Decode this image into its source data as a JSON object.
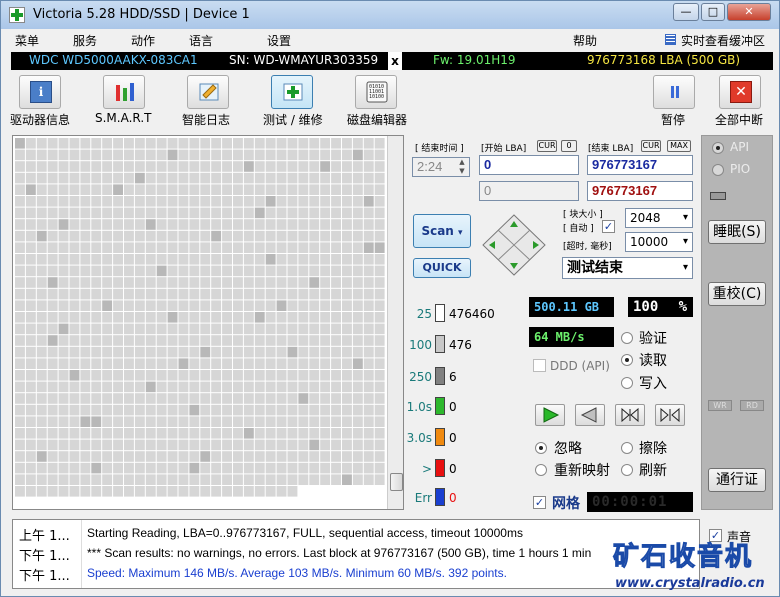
{
  "window": {
    "title": "Victoria 5.28 HDD/SSD | Device 1",
    "minimize": "—",
    "maximize": "□",
    "close": "✕"
  },
  "menu": {
    "items": [
      "菜单",
      "服务",
      "动作",
      "语言",
      "设置",
      "帮助"
    ],
    "cache_view": "实时查看缓冲区"
  },
  "drive": {
    "model": "WDC WD5000AAKX-083CA1",
    "serial": "SN: WD-WMAYUR303359",
    "close": "x",
    "firmware": "Fw: 19.01H19",
    "capacity": "976773168 LBA (500 GB)"
  },
  "toolbar": [
    {
      "label": "驱动器信息",
      "icon": "info-icon"
    },
    {
      "label": "S.M.A.R.T",
      "icon": "smart-icon"
    },
    {
      "label": "智能日志",
      "icon": "log-icon"
    },
    {
      "label": "测试 / 维修",
      "icon": "test-icon"
    },
    {
      "label": "磁盘编辑器",
      "icon": "disk-editor-icon"
    },
    {
      "label": "暂停",
      "icon": "pause-icon"
    },
    {
      "label": "全部中断",
      "icon": "abort-icon"
    }
  ],
  "scan": {
    "end_time_label": "[ 结束时间 ]",
    "start_lba_label": "[开始 LBA]",
    "cur_label": "CUR",
    "zero_label": "0",
    "end_lba_label": "[结束 LBA]",
    "max_label": "MAX",
    "time": "2:24",
    "start_lba": "0",
    "end_lba": "976773167",
    "current_lba": "0",
    "current_end_lba": "976773167",
    "scan_button": "Scan",
    "quick_button": "QUICK",
    "block_size_label": "[ 块大小 ]",
    "auto_label": "[ 自动 ]",
    "timeout_label": "[超时, 毫秒]",
    "block_size": "2048",
    "timeout": "10000",
    "status": "测试结束"
  },
  "legend": [
    {
      "label": "25",
      "count": "476460",
      "color": "#ffffff"
    },
    {
      "label": "100",
      "count": "476",
      "color": "#c8c8c8"
    },
    {
      "label": "250",
      "count": "6",
      "color": "#808080"
    },
    {
      "label": "1.0s",
      "count": "0",
      "color": "#2db82d"
    },
    {
      "label": "3.0s",
      "count": "0",
      "color": "#f08a10"
    },
    {
      "label": ">",
      "count": "0",
      "color": "#e81010"
    },
    {
      "label": "Err",
      "count": "0",
      "color": "#1a3fd0"
    }
  ],
  "stats": {
    "scanned": "500.11 GB",
    "percent": "100",
    "percent_unit": "%",
    "speed": "64 MB/s",
    "ddd": "DDD (API)"
  },
  "modes": {
    "verify": "验证",
    "read": "读取",
    "write": "写入"
  },
  "repair": {
    "ignore": "忽略",
    "erase": "擦除",
    "remap": "重新映射",
    "refresh": "刷新"
  },
  "grid": {
    "label": "网格",
    "timer": "00:00:01"
  },
  "right_panel": {
    "api": "API",
    "pio": "PIO",
    "sleep": "睡眠(S)",
    "recal": "重校(C)",
    "wr": "WR",
    "rd": "RD",
    "passport": "通行证",
    "sound": "声音"
  },
  "log": [
    {
      "time": "上午 1...",
      "msg": "Starting Reading, LBA=0..976773167, FULL, sequential access, timeout 10000ms",
      "color": "#000000"
    },
    {
      "time": "下午 1...",
      "msg": "*** Scan results: no warnings, no errors. Last block at 976773167 (500 GB), time 1 hours 1 min",
      "color": "#000000"
    },
    {
      "time": "下午 1...",
      "msg": "Speed: Maximum 146 MB/s. Average 103 MB/s. Minimum 60 MB/s. 392 points.",
      "color": "#1a3fd0"
    }
  ],
  "watermark": {
    "title": "矿石收音机",
    "url": "www.crystalradio.cn"
  }
}
